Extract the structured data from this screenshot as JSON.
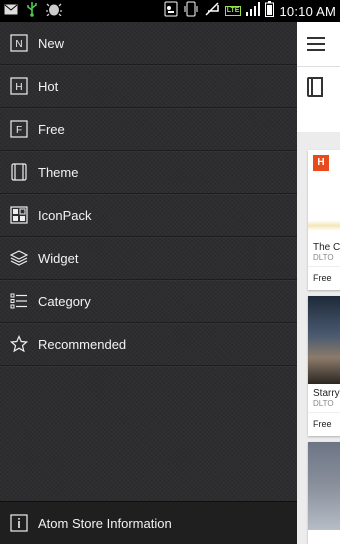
{
  "status_bar": {
    "time": "10:10 AM",
    "network": "LTE",
    "icons": [
      "mail-icon",
      "usb-icon",
      "android-debug-icon",
      "sim-icon",
      "vibrate-icon",
      "no-signal-icon",
      "lte-icon",
      "signal-icon",
      "battery-icon"
    ]
  },
  "drawer": {
    "items": [
      {
        "label": "New",
        "icon": "new-icon"
      },
      {
        "label": "Hot",
        "icon": "hot-icon"
      },
      {
        "label": "Free",
        "icon": "free-icon"
      },
      {
        "label": "Theme",
        "icon": "theme-icon"
      },
      {
        "label": "IconPack",
        "icon": "iconpack-icon"
      },
      {
        "label": "Widget",
        "icon": "widget-icon"
      },
      {
        "label": "Category",
        "icon": "category-icon"
      },
      {
        "label": "Recommended",
        "icon": "star-icon"
      }
    ],
    "footer": {
      "label": "Atom Store Information",
      "icon": "info-icon"
    }
  },
  "app": {
    "cards": [
      {
        "badge": "H",
        "title": "The C",
        "author": "DLTO",
        "price": "Free"
      },
      {
        "title": "Starry",
        "author": "DLTO",
        "price": "Free"
      },
      {
        "title": "",
        "author": "",
        "price": ""
      }
    ]
  },
  "colors": {
    "drawer_bg": "#2d2d2f",
    "footer_bg": "#1f1f20",
    "hot_badge": "#e84a1b",
    "lte": "#9ae34a"
  }
}
